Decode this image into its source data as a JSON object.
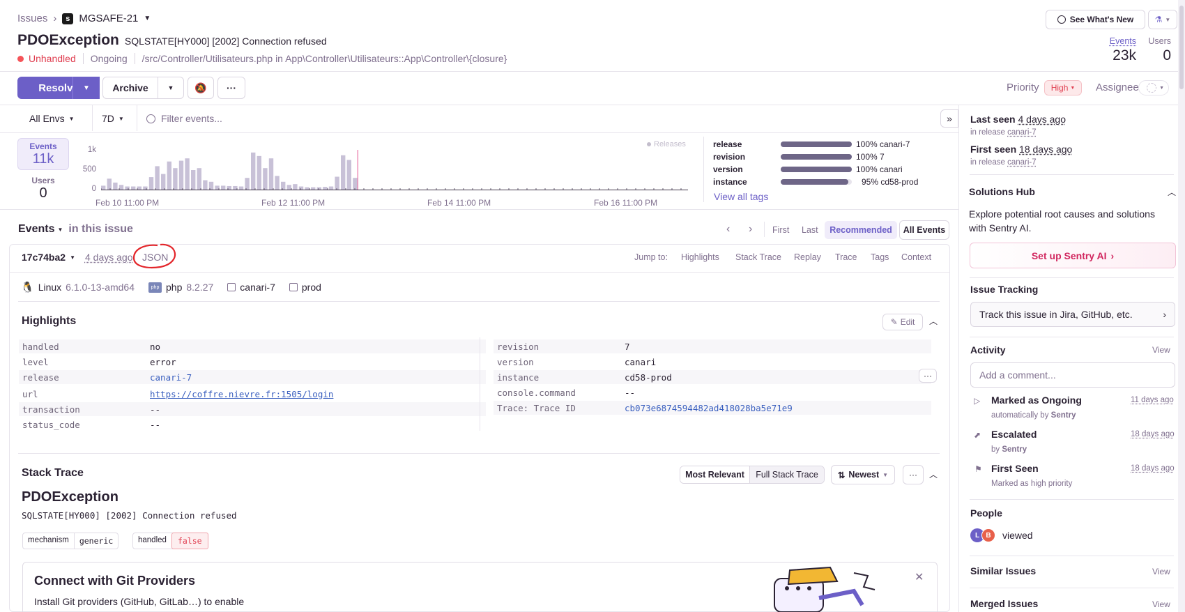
{
  "breadcrumb": {
    "root": "Issues",
    "project": "MGSAFE-21"
  },
  "header": {
    "title": "PDOException",
    "subtitle": "SQLSTATE[HY000] [2002] Connection refused",
    "status": "Unhandled",
    "substatus": "Ongoing",
    "culprit": "/src/Controller/Utilisateurs.php in App\\Controller\\Utilisateurs::App\\Controller\\{closure}",
    "whats_new": "See What's New",
    "events_label": "Events",
    "events_value": "23k",
    "users_label": "Users",
    "users_value": "0"
  },
  "toolbar": {
    "resolve": "Resolve",
    "archive": "Archive",
    "priority_label": "Priority",
    "priority_value": "High",
    "assignee_label": "Assignee"
  },
  "filters": {
    "env": "All Envs",
    "period": "7D",
    "search_placeholder": "Filter events..."
  },
  "graph": {
    "events_label": "Events",
    "events_value": "11k",
    "users_label": "Users",
    "users_value": "0",
    "y_ticks": [
      "1k",
      "500",
      "0"
    ],
    "x_ticks": [
      "Feb 10 11:00 PM",
      "Feb 12 11:00 PM",
      "Feb 14 11:00 PM",
      "Feb 16 11:00 PM"
    ],
    "releases_label": "Releases",
    "bars": [
      0.1,
      0.28,
      0.18,
      0.12,
      0.08,
      0.08,
      0.08,
      0.08,
      0.32,
      0.6,
      0.4,
      0.72,
      0.55,
      0.74,
      0.8,
      0.5,
      0.55,
      0.24,
      0.2,
      0.1,
      0.1,
      0.09,
      0.09,
      0.08,
      0.3,
      0.95,
      0.86,
      0.55,
      0.8,
      0.35,
      0.2,
      0.12,
      0.14,
      0.08,
      0.06,
      0.06,
      0.06,
      0.07,
      0.08,
      0.33,
      0.88,
      0.76,
      0.3
    ],
    "marker_color": "#e86fa2",
    "bar_color": "#c8c1d7"
  },
  "tags": {
    "rows": [
      {
        "key": "release",
        "value": "100% canari-7",
        "fill": 1.0
      },
      {
        "key": "revision",
        "value": "100% 7",
        "fill": 1.0
      },
      {
        "key": "version",
        "value": "100% canari",
        "fill": 1.0
      },
      {
        "key": "instance",
        "value": "95% cd58-prod",
        "fill": 0.95
      }
    ],
    "view_all": "View all tags"
  },
  "events_section": {
    "title": "Events",
    "subtitle": "in this issue",
    "first": "First",
    "last": "Last",
    "recommended": "Recommended",
    "all_events": "All Events",
    "event_id": "17c74ba2",
    "age": "4 days ago",
    "json": "JSON",
    "jump_to": "Jump to:",
    "jumps": [
      "Highlights",
      "Stack Trace",
      "Replay",
      "Trace",
      "Tags",
      "Context"
    ]
  },
  "context": {
    "os": "Linux",
    "os_version": "6.1.0-13-amd64",
    "runtime": "php",
    "runtime_version": "8.2.27",
    "release": "canari-7",
    "env": "prod"
  },
  "highlights": {
    "title": "Highlights",
    "edit": "Edit",
    "left": [
      {
        "k": "handled",
        "v": "no"
      },
      {
        "k": "level",
        "v": "error"
      },
      {
        "k": "release",
        "v": "canari-7"
      },
      {
        "k": "url",
        "v": "https://coffre.nievre.fr:1505/login"
      },
      {
        "k": "transaction",
        "v": "--"
      },
      {
        "k": "status_code",
        "v": "--"
      }
    ],
    "right": [
      {
        "k": "revision",
        "v": "7"
      },
      {
        "k": "version",
        "v": "canari"
      },
      {
        "k": "instance",
        "v": "cd58-prod"
      },
      {
        "k": "console.command",
        "v": "--"
      },
      {
        "k": "Trace: Trace ID",
        "v": "cb073e6874594482ad418028ba5e71e9"
      }
    ]
  },
  "stack": {
    "title": "Stack Trace",
    "most_relevant": "Most Relevant",
    "full": "Full Stack Trace",
    "sort": "Newest",
    "exception": "PDOException",
    "message": "SQLSTATE[HY000] [2002] Connection refused",
    "mechanism": "mechanism",
    "mechanism_value": "generic",
    "handled": "handled",
    "handled_value": "false"
  },
  "git": {
    "title": "Connect with Git Providers",
    "body": "Install Git providers (GitHub, GitLab…) to enable"
  },
  "sidebar": {
    "last_seen": "Last seen",
    "last_seen_value": "4 days ago",
    "last_release_prefix": "in release",
    "last_release": "canari-7",
    "first_seen": "First seen",
    "first_seen_value": "18 days ago",
    "first_release_prefix": "in release",
    "first_release": "canari-7",
    "solutions_title": "Solutions Hub",
    "solutions_body": "Explore potential root causes and solutions with Sentry AI.",
    "setup_ai": "Set up Sentry AI",
    "tracking_title": "Issue Tracking",
    "tracking_btn": "Track this issue in Jira, GitHub, etc.",
    "activity_title": "Activity",
    "view": "View",
    "comment_placeholder": "Add a comment...",
    "activities": [
      {
        "title": "Marked as Ongoing",
        "sub_prefix": "automatically by",
        "sub_strong": "Sentry",
        "time": "11 days ago"
      },
      {
        "title": "Escalated",
        "sub_prefix": "by",
        "sub_strong": "Sentry",
        "time": "18 days ago"
      },
      {
        "title": "First Seen",
        "sub_prefix": "Marked as high priority",
        "sub_strong": "",
        "time": "18 days ago"
      }
    ],
    "people_title": "People",
    "people_viewed": "viewed",
    "avatar1": "L",
    "avatar2": "B",
    "similar": "Similar Issues",
    "merged": "Merged Issues"
  },
  "colors": {
    "accent": "#6c5fc7",
    "error": "#f55459",
    "priority_bg": "#fde9ea",
    "priority_fg": "#e03e50",
    "annotation": "#e3252a"
  }
}
